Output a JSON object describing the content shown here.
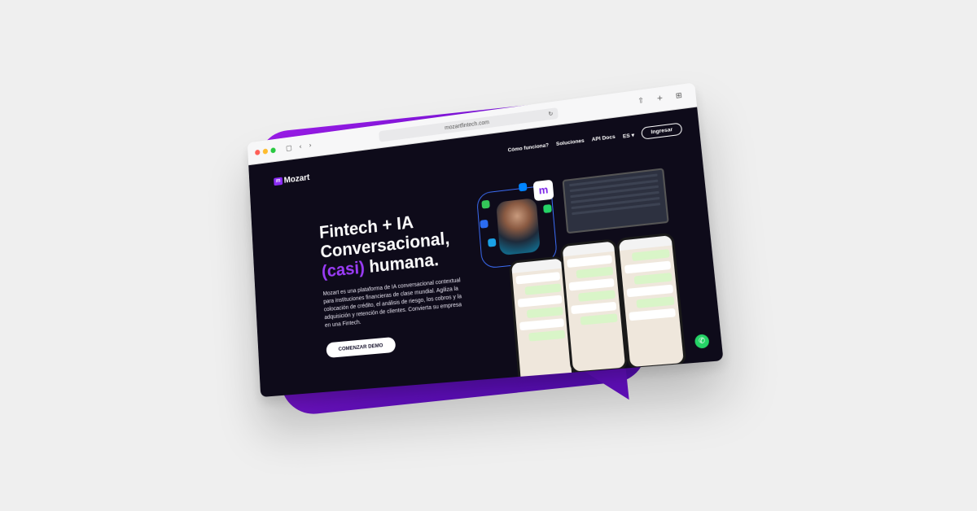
{
  "browser": {
    "url": "mozartfintech.com",
    "reload_icon": "↻",
    "sidebar_icon": "▢",
    "back_icon": "‹",
    "forward_icon": "›",
    "right_icons": "⇧ + ⊞"
  },
  "site": {
    "logo_mark": "m",
    "logo_text": "Mozart",
    "nav": {
      "how": "Cómo funciona?",
      "solutions": "Soluciones",
      "api": "API Docs",
      "lang": "ES ▾",
      "login": "Ingresar"
    },
    "hero": {
      "line1": "Fintech + IA",
      "line2": "Conversacional,",
      "accent": "(casi)",
      "line3_rest": " humana.",
      "description": "Mozart es una plataforma de IA conversacional contextual para instituciones financieras de clase mundial. Agiliza la colocación de crédito, el análisis de riesgo, los cobros y la adquisición y retención de clientes. Convierta su empresa en una Fintech.",
      "cta": "COMENZAR DEMO"
    },
    "brand_mark": "m",
    "whatsapp_icon": "✆"
  },
  "colors": {
    "accent": "#9b3cf7",
    "page_bg": "#0e0b1a",
    "bubble": "#6a0fd0"
  }
}
